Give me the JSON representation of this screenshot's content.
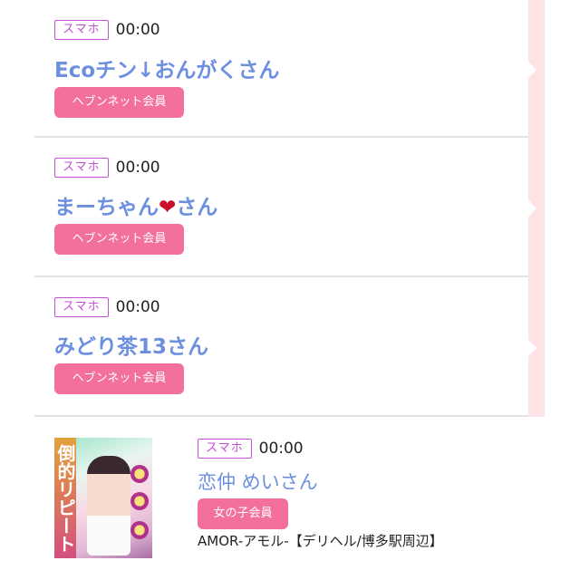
{
  "entries": [
    {
      "device": "スマホ",
      "time": "00:00",
      "name": "Eco",
      "name_suffix": "チン↓おんがくさん",
      "member": "ヘブンネット会員"
    },
    {
      "device": "スマホ",
      "time": "00:00",
      "name_pre": "まーちゃん",
      "heart": "❤",
      "name_post": "さん",
      "member": "ヘブンネット会員"
    },
    {
      "device": "スマホ",
      "time": "00:00",
      "name": "みどり茶13さん",
      "member": "ヘブンネット会員"
    }
  ],
  "shop_entry": {
    "device": "スマホ",
    "time": "00:00",
    "name": "恋仲 めいさん",
    "member": "女の子会員",
    "shop": "AMOR-アモル-【デリヘル/博多駅周辺】",
    "thumb_text": "倒的リピート"
  },
  "colors": {
    "device_border": "#c44fd6",
    "name": "#6c8fe0",
    "member_button": "#f2709a",
    "heart": "#c8102e",
    "side_stripe": "#fde3e6"
  }
}
